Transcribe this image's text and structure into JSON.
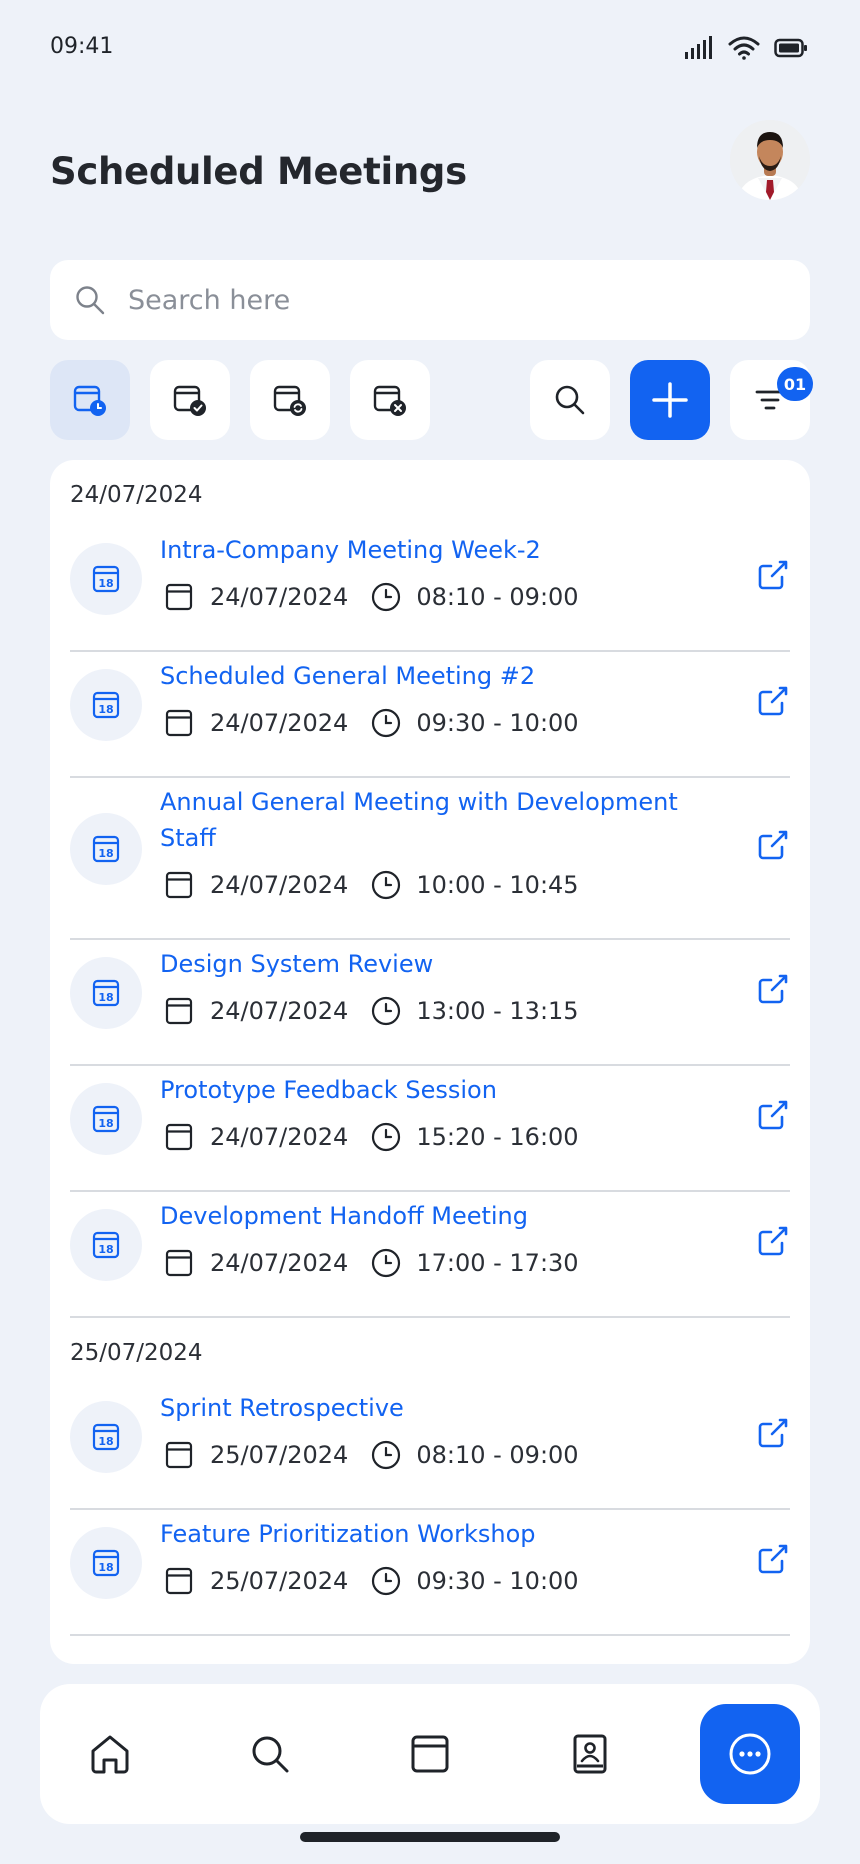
{
  "status_bar": {
    "time": "09:41"
  },
  "header": {
    "title": "Scheduled Meetings"
  },
  "search": {
    "placeholder": "Search here"
  },
  "toolbar": {
    "filter_badge": "01"
  },
  "groups": [
    {
      "date": "24/07/2024",
      "meetings": [
        {
          "title": "Intra-Company Meeting Week-2",
          "date": "24/07/2024",
          "time": "08:10 - 09:00"
        },
        {
          "title": "Scheduled General Meeting #2",
          "date": "24/07/2024",
          "time": "09:30 - 10:00"
        },
        {
          "title": "Annual General Meeting with Development Staff",
          "date": "24/07/2024",
          "time": "10:00 - 10:45"
        },
        {
          "title": "Design System Review",
          "date": "24/07/2024",
          "time": "13:00 - 13:15"
        },
        {
          "title": "Prototype Feedback Session",
          "date": "24/07/2024",
          "time": "15:20 - 16:00"
        },
        {
          "title": "Development Handoff Meeting",
          "date": "24/07/2024",
          "time": "17:00 - 17:30"
        }
      ]
    },
    {
      "date": "25/07/2024",
      "meetings": [
        {
          "title": "Sprint Retrospective",
          "date": "25/07/2024",
          "time": "08:10 - 09:00"
        },
        {
          "title": "Feature Prioritization Workshop",
          "date": "25/07/2024",
          "time": "09:30 - 10:00"
        }
      ]
    }
  ],
  "calendar_icon_day": "18",
  "colors": {
    "accent": "#1263f1",
    "background": "#eef2f9",
    "text": "#1f2329"
  }
}
